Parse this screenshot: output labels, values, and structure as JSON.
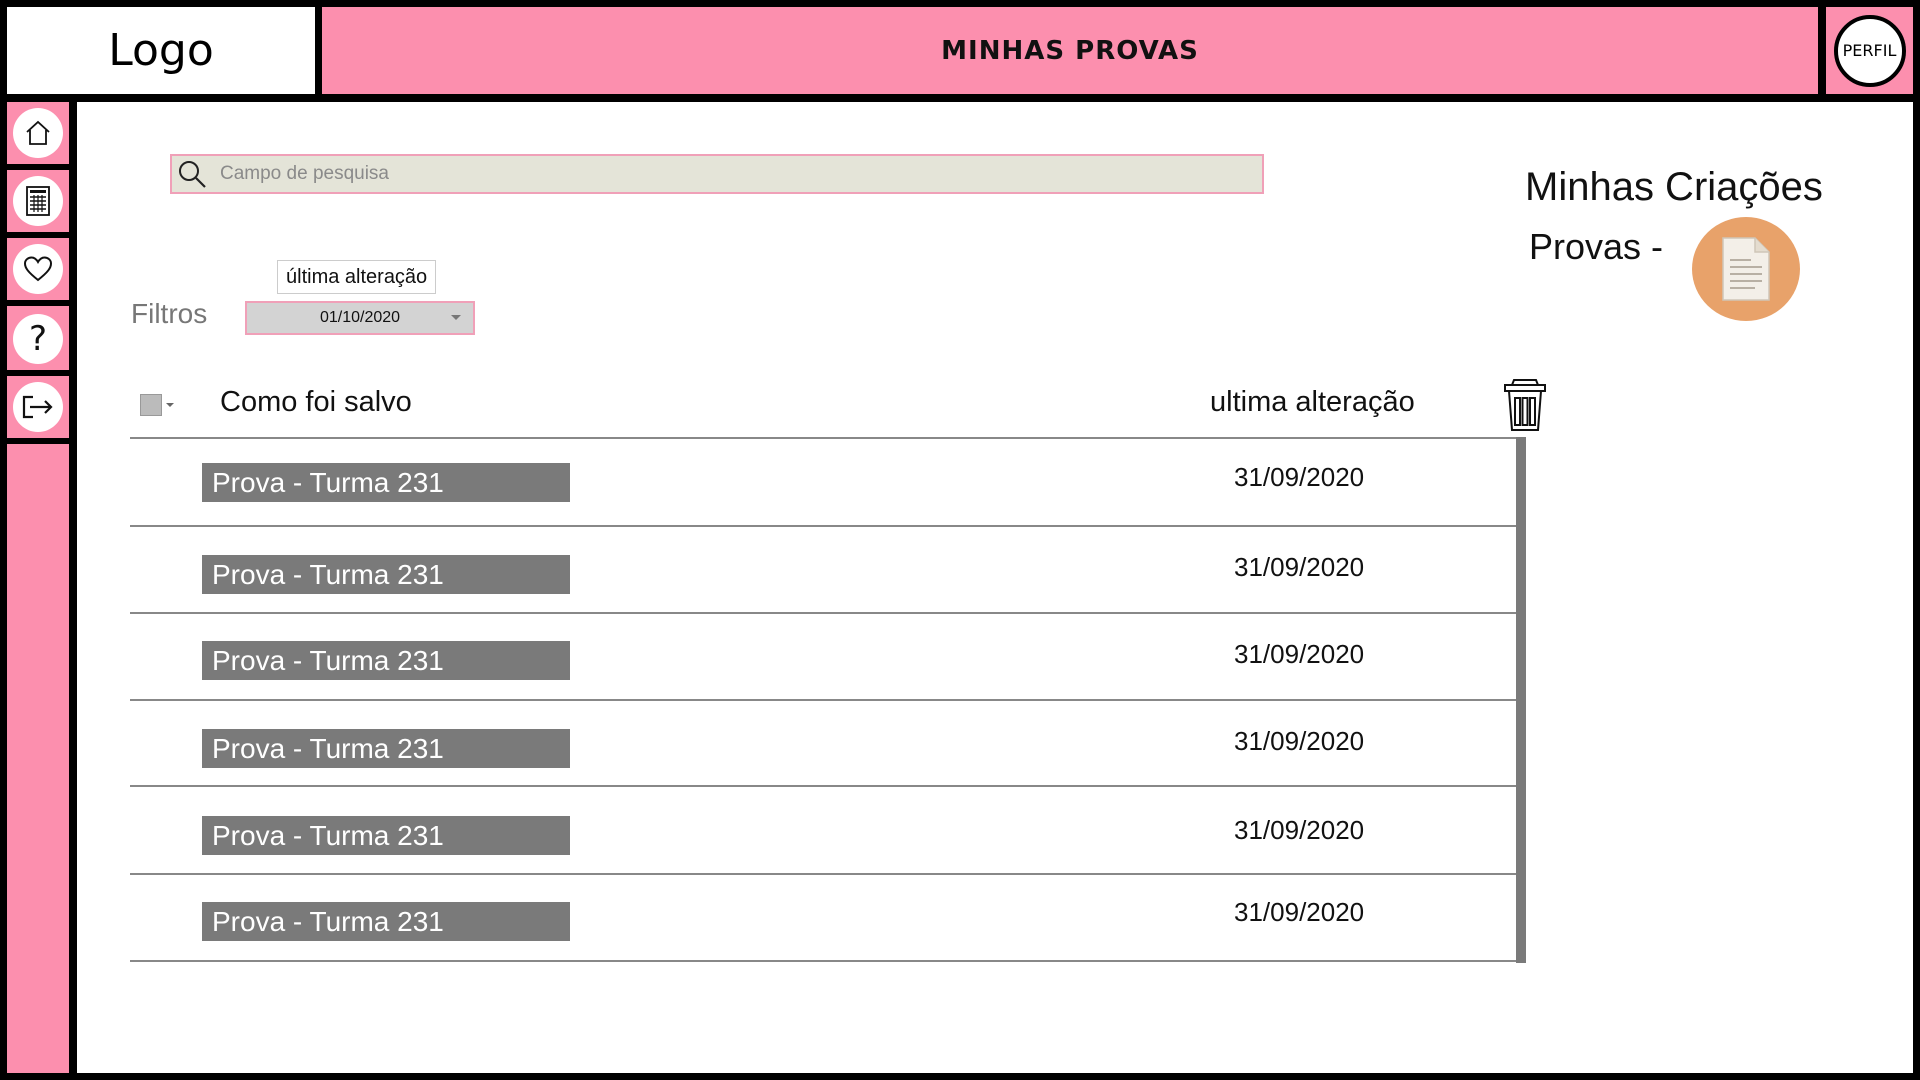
{
  "header": {
    "logo_text": "Logo",
    "title": "MINHAS PROVAS",
    "profile_label": "PERFIL"
  },
  "sidebar": {
    "items": [
      {
        "name": "home",
        "icon": "home-icon"
      },
      {
        "name": "documents",
        "icon": "document-list-icon"
      },
      {
        "name": "favorites",
        "icon": "heart-icon"
      },
      {
        "name": "help",
        "icon": "question-icon"
      },
      {
        "name": "logout",
        "icon": "logout-icon"
      }
    ]
  },
  "search": {
    "placeholder": "Campo de pesquisa"
  },
  "filters": {
    "label": "Filtros",
    "tooltip": "última alteração",
    "selected_date": "01/10/2020"
  },
  "table": {
    "col_saved_as": "Como foi salvo",
    "col_last_modified": "ultima alteração",
    "rows": [
      {
        "name": "Prova - Turma 231",
        "date": "31/09/2020"
      },
      {
        "name": "Prova - Turma 231",
        "date": "31/09/2020"
      },
      {
        "name": "Prova - Turma 231",
        "date": "31/09/2020"
      },
      {
        "name": "Prova - Turma 231",
        "date": "31/09/2020"
      },
      {
        "name": "Prova - Turma 231",
        "date": "31/09/2020"
      },
      {
        "name": "Prova - Turma 231",
        "date": "31/09/2020"
      }
    ]
  },
  "creations": {
    "title": "Minhas Criações",
    "subtitle": "Provas -"
  },
  "colors": {
    "accent_pink": "#fc8fae",
    "row_label_gray": "#7a7a7a",
    "doc_circle_orange": "#e8a26a"
  }
}
